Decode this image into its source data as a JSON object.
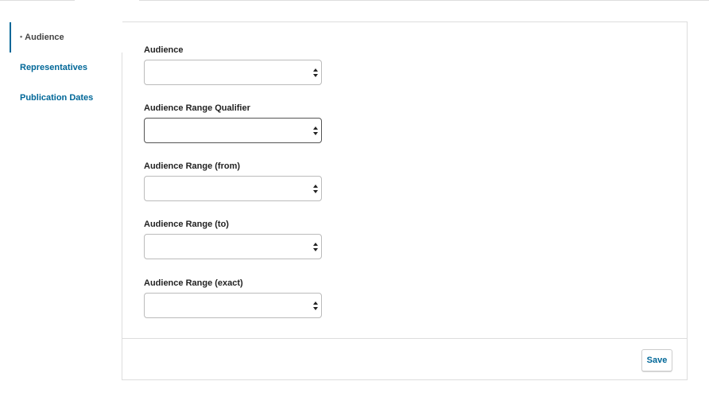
{
  "sidebar": {
    "items": [
      {
        "label": "Audience",
        "active": true
      },
      {
        "label": "Representatives",
        "active": false
      },
      {
        "label": "Publication Dates",
        "active": false
      }
    ]
  },
  "form": {
    "fields": [
      {
        "label": "Audience",
        "value": ""
      },
      {
        "label": "Audience Range Qualifier",
        "value": ""
      },
      {
        "label": "Audience Range (from)",
        "value": ""
      },
      {
        "label": "Audience Range (to)",
        "value": ""
      },
      {
        "label": "Audience Range (exact)",
        "value": ""
      }
    ]
  },
  "footer": {
    "save_label": "Save"
  },
  "colors": {
    "accent": "#006798",
    "border": "#dddddd"
  }
}
